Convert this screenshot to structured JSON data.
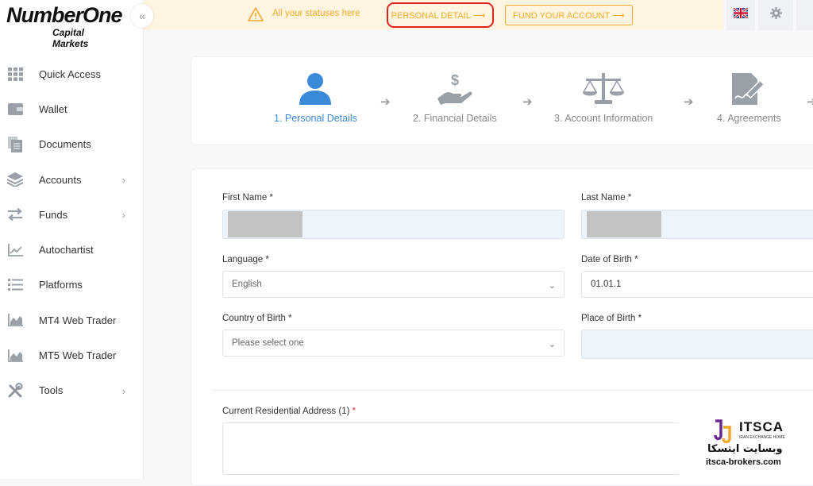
{
  "brand": {
    "name": "NumberOne",
    "subtitle": "Capital Markets"
  },
  "sidebar": {
    "items": [
      {
        "label": "Quick Access",
        "icon": "grid-icon",
        "has_submenu": false
      },
      {
        "label": "Wallet",
        "icon": "wallet-icon",
        "has_submenu": false
      },
      {
        "label": "Documents",
        "icon": "documents-icon",
        "has_submenu": false
      },
      {
        "label": "Accounts",
        "icon": "layers-icon",
        "has_submenu": true
      },
      {
        "label": "Funds",
        "icon": "transfer-icon",
        "has_submenu": true
      },
      {
        "label": "Autochartist",
        "icon": "chart-line-icon",
        "has_submenu": false
      },
      {
        "label": "Platforms",
        "icon": "list-icon",
        "has_submenu": false
      },
      {
        "label": "MT4 Web Trader",
        "icon": "area-chart-icon",
        "has_submenu": false
      },
      {
        "label": "MT5 Web Trader",
        "icon": "area-chart-icon",
        "has_submenu": false
      },
      {
        "label": "Tools",
        "icon": "tools-icon",
        "has_submenu": true
      }
    ]
  },
  "topbar": {
    "notice": "All your statuses here",
    "personal_detail_btn": "PERSONAL DETAIL ⟶",
    "fund_account_btn": "FUND YOUR ACCOUNT ⟶",
    "accent": "#f0a92c"
  },
  "steps": [
    {
      "label": "1. Personal Details",
      "active": true
    },
    {
      "label": "2. Financial Details",
      "active": false
    },
    {
      "label": "3. Account Information",
      "active": false
    },
    {
      "label": "4. Agreements",
      "active": false
    }
  ],
  "form": {
    "first_name_label": "First Name *",
    "last_name_label": "Last Name *",
    "language_label": "Language *",
    "language_value": "English",
    "dob_label": "Date of Birth *",
    "dob_value": "01.01.1",
    "country_label": "Country of Birth *",
    "country_placeholder": "Please select one",
    "place_label": "Place of Birth *",
    "address_label": "Current Residential Address (1)",
    "address_required_mark": "*"
  },
  "watermark": {
    "brand": "ITSCA",
    "tagline": "IRAN EXCHANGE HOME",
    "persian": "وبسایت ایتسکا",
    "url": "itsca-brokers.com"
  }
}
